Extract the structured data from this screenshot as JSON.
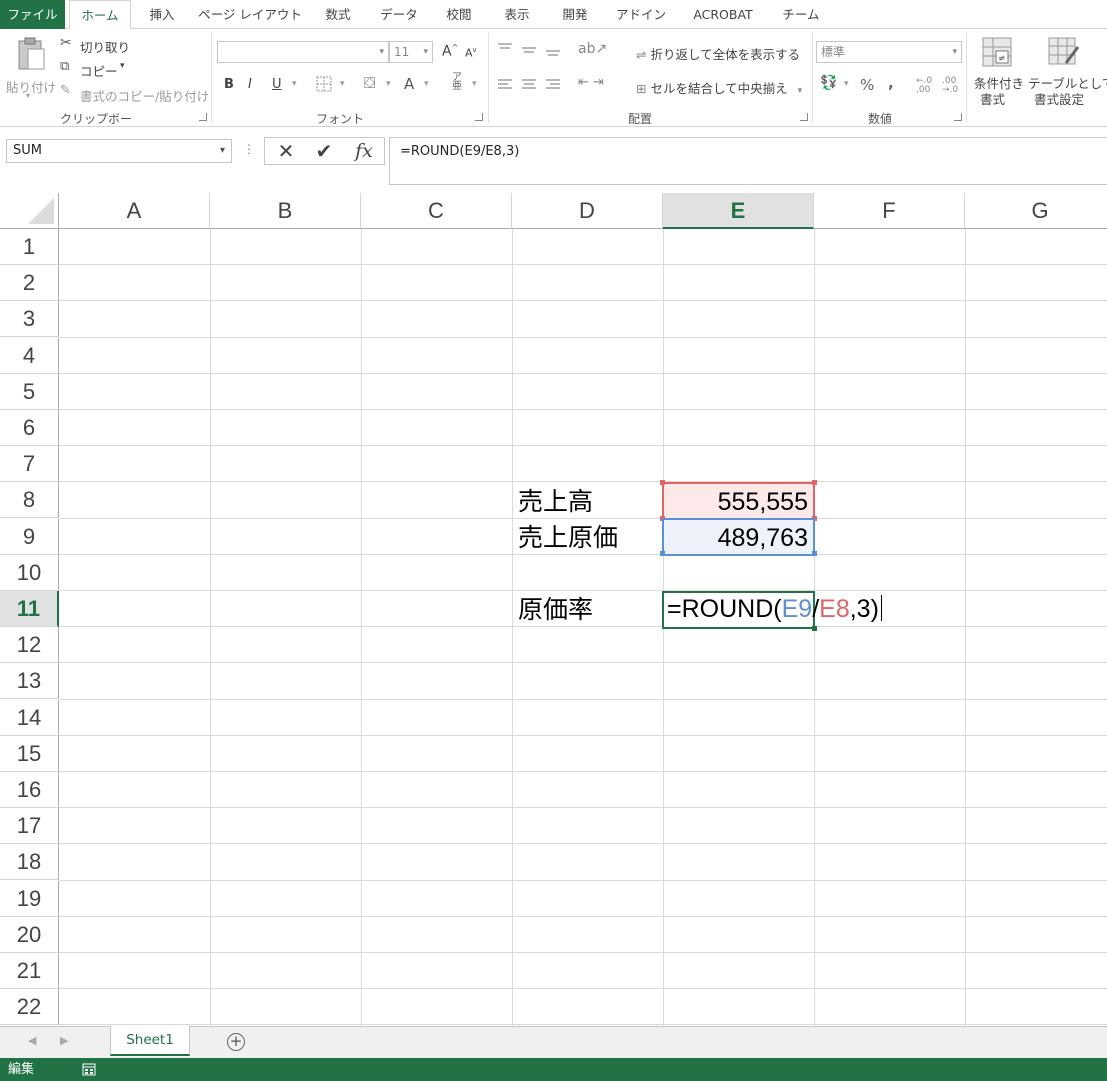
{
  "tabs": [
    "ファイル",
    "ホーム",
    "挿入",
    "ページ レイアウト",
    "数式",
    "データ",
    "校閲",
    "表示",
    "開発",
    "アドイン",
    "ACROBAT",
    "チーム"
  ],
  "ribbon": {
    "clipboard": {
      "paste": "貼り付け",
      "cut": "切り取り",
      "copy": "コピー",
      "format_painter": "書式のコピー/貼り付け",
      "label": "クリップボード"
    },
    "font": {
      "size": "11",
      "bold": "B",
      "italic": "I",
      "underline": "U",
      "grow": "A",
      "shrink": "A",
      "color_a": "A",
      "label": "フォント"
    },
    "alignment": {
      "wrap_text": "折り返して全体を表示する",
      "merge_center": "セルを結合して中央揃え",
      "label": "配置"
    },
    "number": {
      "format": "標準",
      "percent": "%",
      "comma": ",",
      "label": "数値"
    },
    "styles": {
      "conditional_formatting_1": "条件付き",
      "conditional_formatting_2": "書式",
      "table_format_1": "テーブルとして",
      "table_format_2": "書式設定"
    }
  },
  "formula_bar": {
    "name_box": "SUM",
    "fx": "fx",
    "formula": "=ROUND(E9/E8,3)"
  },
  "columns": [
    "A",
    "B",
    "C",
    "D",
    "E",
    "F",
    "G"
  ],
  "rows": [
    "1",
    "2",
    "3",
    "4",
    "5",
    "6",
    "7",
    "8",
    "9",
    "10",
    "11",
    "12",
    "13",
    "14",
    "15",
    "16",
    "17",
    "18",
    "19",
    "20",
    "21",
    "22"
  ],
  "cells": {
    "d8": "売上高",
    "e8": "555,555",
    "d9": "売上原価",
    "e9": "489,763",
    "d11": "原価率",
    "e11_parts": {
      "prefix": "=ROUND(",
      "ref1": "E9",
      "slash": "/",
      "ref2": "E8",
      "suffix": ",3)"
    }
  },
  "sheets": [
    "Sheet1"
  ],
  "add_sheet": "+",
  "status": {
    "mode": "編集"
  },
  "colors": {
    "accent": "#217346",
    "ref_red": "#e06666",
    "ref_blue": "#5b8fd6"
  }
}
